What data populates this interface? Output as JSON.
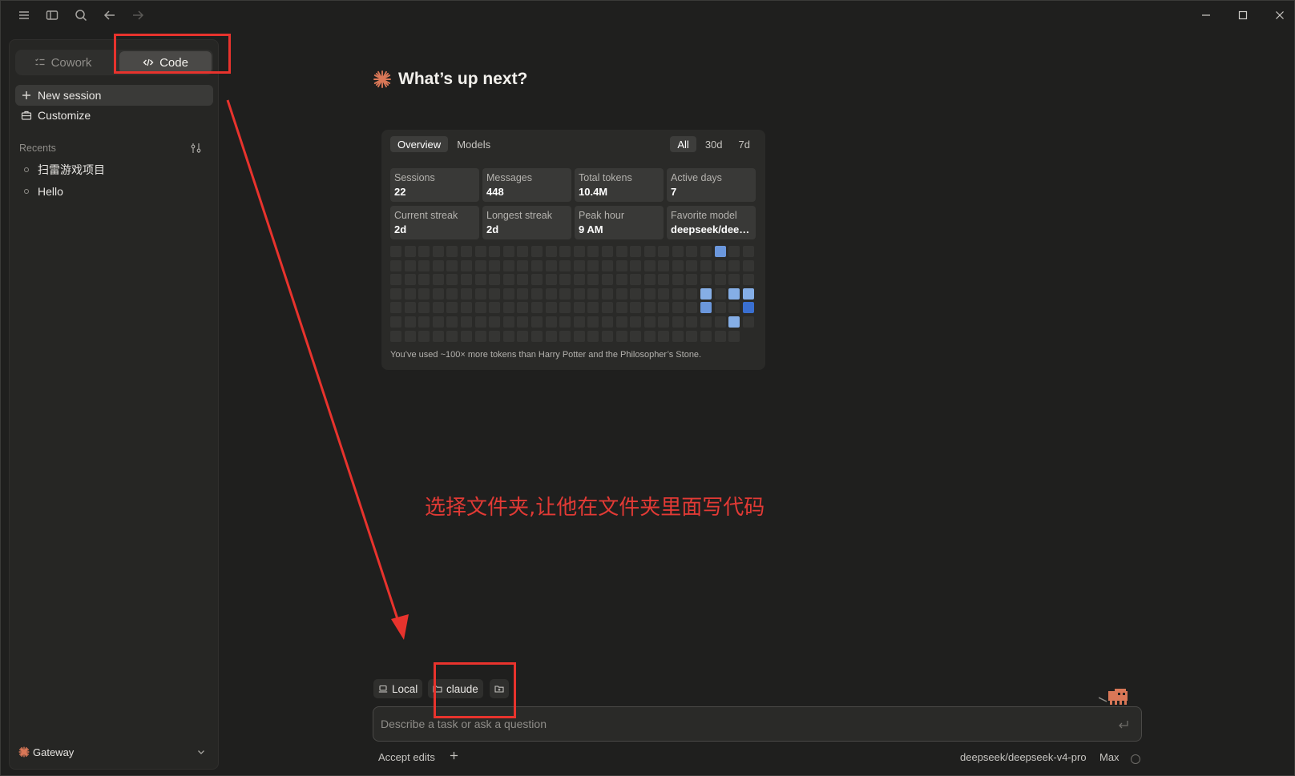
{
  "sidebar": {
    "modes": [
      {
        "label": "Cowork",
        "icon": "checklist-icon"
      },
      {
        "label": "Code",
        "icon": "code-icon",
        "active": true
      }
    ],
    "new_session_label": "New session",
    "customize_label": "Customize",
    "recents_label": "Recents",
    "recents": [
      {
        "label": "扫雷游戏项目"
      },
      {
        "label": "Hello"
      }
    ],
    "gateway_label": "Gateway"
  },
  "main": {
    "heading": "What’s up next?",
    "stats": {
      "tabs": [
        "Overview",
        "Models"
      ],
      "active_tab": "Overview",
      "ranges": [
        "All",
        "30d",
        "7d"
      ],
      "active_range": "All",
      "cards": [
        {
          "label": "Sessions",
          "value": "22"
        },
        {
          "label": "Messages",
          "value": "448"
        },
        {
          "label": "Total tokens",
          "value": "10.4M"
        },
        {
          "label": "Active days",
          "value": "7"
        },
        {
          "label": "Current streak",
          "value": "2d"
        },
        {
          "label": "Longest streak",
          "value": "2d"
        },
        {
          "label": "Peak hour",
          "value": "9 AM"
        },
        {
          "label": "Favorite model",
          "value": "deepseek/deep..."
        }
      ],
      "heatmap": {
        "weeks": 26,
        "days": 7,
        "active_cells": [
          {
            "week": 23,
            "day": 0,
            "level": 2
          },
          {
            "week": 22,
            "day": 3,
            "level": 1
          },
          {
            "week": 24,
            "day": 3,
            "level": 1
          },
          {
            "week": 25,
            "day": 3,
            "level": 1
          },
          {
            "week": 22,
            "day": 4,
            "level": 2
          },
          {
            "week": 25,
            "day": 4,
            "level": 3
          },
          {
            "week": 24,
            "day": 5,
            "level": 1
          }
        ],
        "empty_cells": [
          {
            "week": 25,
            "day": 6
          }
        ]
      },
      "note": "You’ve used ~100× more tokens than Harry Potter and the Philosopher’s Stone."
    },
    "annotation": "选择文件夹,让他在文件夹里面写代码"
  },
  "composer": {
    "env_label": "Local",
    "folder_label": "claude",
    "placeholder": "Describe a task or ask a question",
    "accept_edits_label": "Accept edits",
    "model_label": "deepseek/deepseek-v4-pro",
    "effort_label": "Max"
  },
  "colors": {
    "background": "#1f1f1e",
    "sidebar": "#262624",
    "accent_orange": "#d97757",
    "annotation_red": "#e8332d",
    "heat_low": "#85aee6",
    "heat_mid": "#6b97dc",
    "heat_high": "#3a6fd0"
  }
}
